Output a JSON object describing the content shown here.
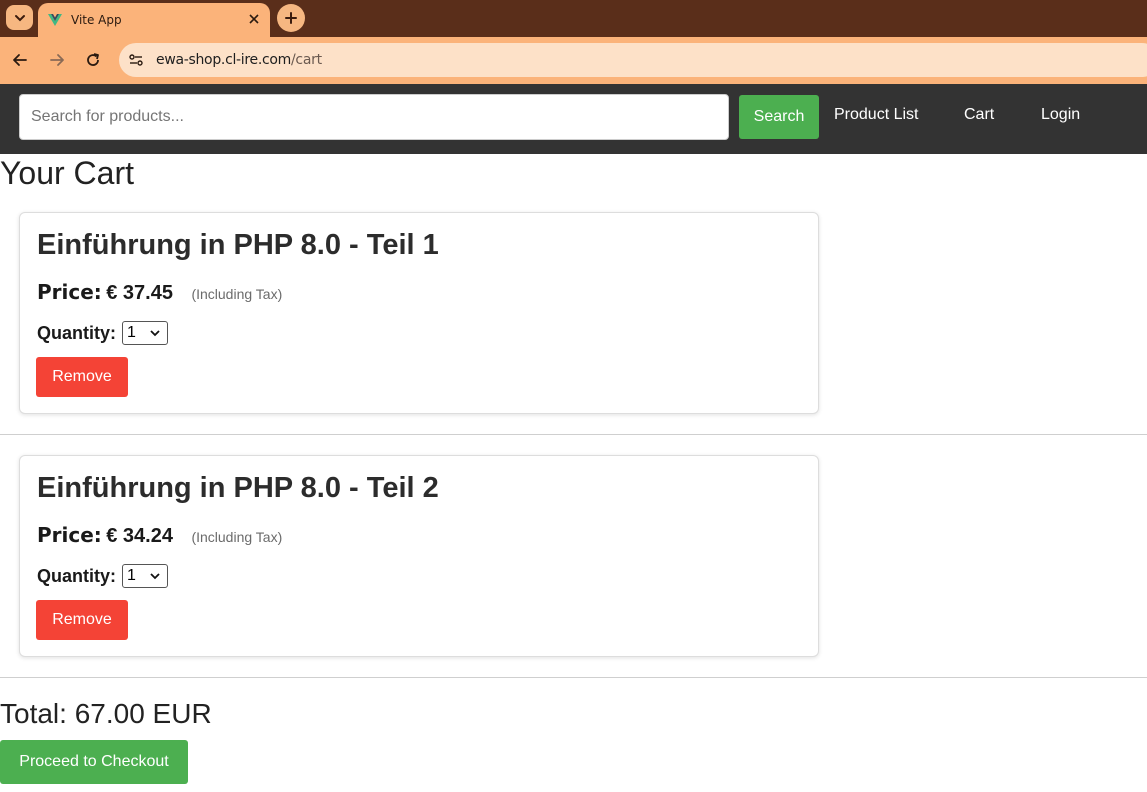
{
  "browser": {
    "tab_title": "Vite App",
    "url_host": "ewa-shop.cl-ire.com",
    "url_path": "/cart",
    "colors": {
      "tabbar": "#5a2e1a",
      "toolbar": "#fbb37a",
      "omnibox": "#fde1c8"
    }
  },
  "nav": {
    "search_placeholder": "Search for products...",
    "search_button": "Search",
    "links": [
      "Product List",
      "Cart",
      "Login"
    ],
    "colors": {
      "background": "#333333",
      "accent": "#4caf50"
    }
  },
  "page": {
    "title": "Your Cart"
  },
  "cart": {
    "items": [
      {
        "title": "Einführung in PHP 8.0 - Teil 1",
        "price_label": "Price:",
        "price_value": "€ 37.45",
        "tax_note": "(Including Tax)",
        "quantity_label": "Quantity:",
        "quantity": "1",
        "remove_label": "Remove"
      },
      {
        "title": "Einführung in PHP 8.0 - Teil 2",
        "price_label": "Price:",
        "price_value": "€ 34.24",
        "tax_note": "(Including Tax)",
        "quantity_label": "Quantity:",
        "quantity": "1",
        "remove_label": "Remove"
      }
    ],
    "total": "Total: 67.00 EUR",
    "checkout_label": "Proceed to Checkout",
    "colors": {
      "remove": "#f44336",
      "checkout": "#4caf50"
    }
  },
  "icons": [
    "tab-list-icon",
    "vue-logo-icon",
    "close-icon",
    "new-tab-icon",
    "back-icon",
    "forward-icon",
    "reload-icon",
    "site-info-icon",
    "chevron-down-icon"
  ]
}
